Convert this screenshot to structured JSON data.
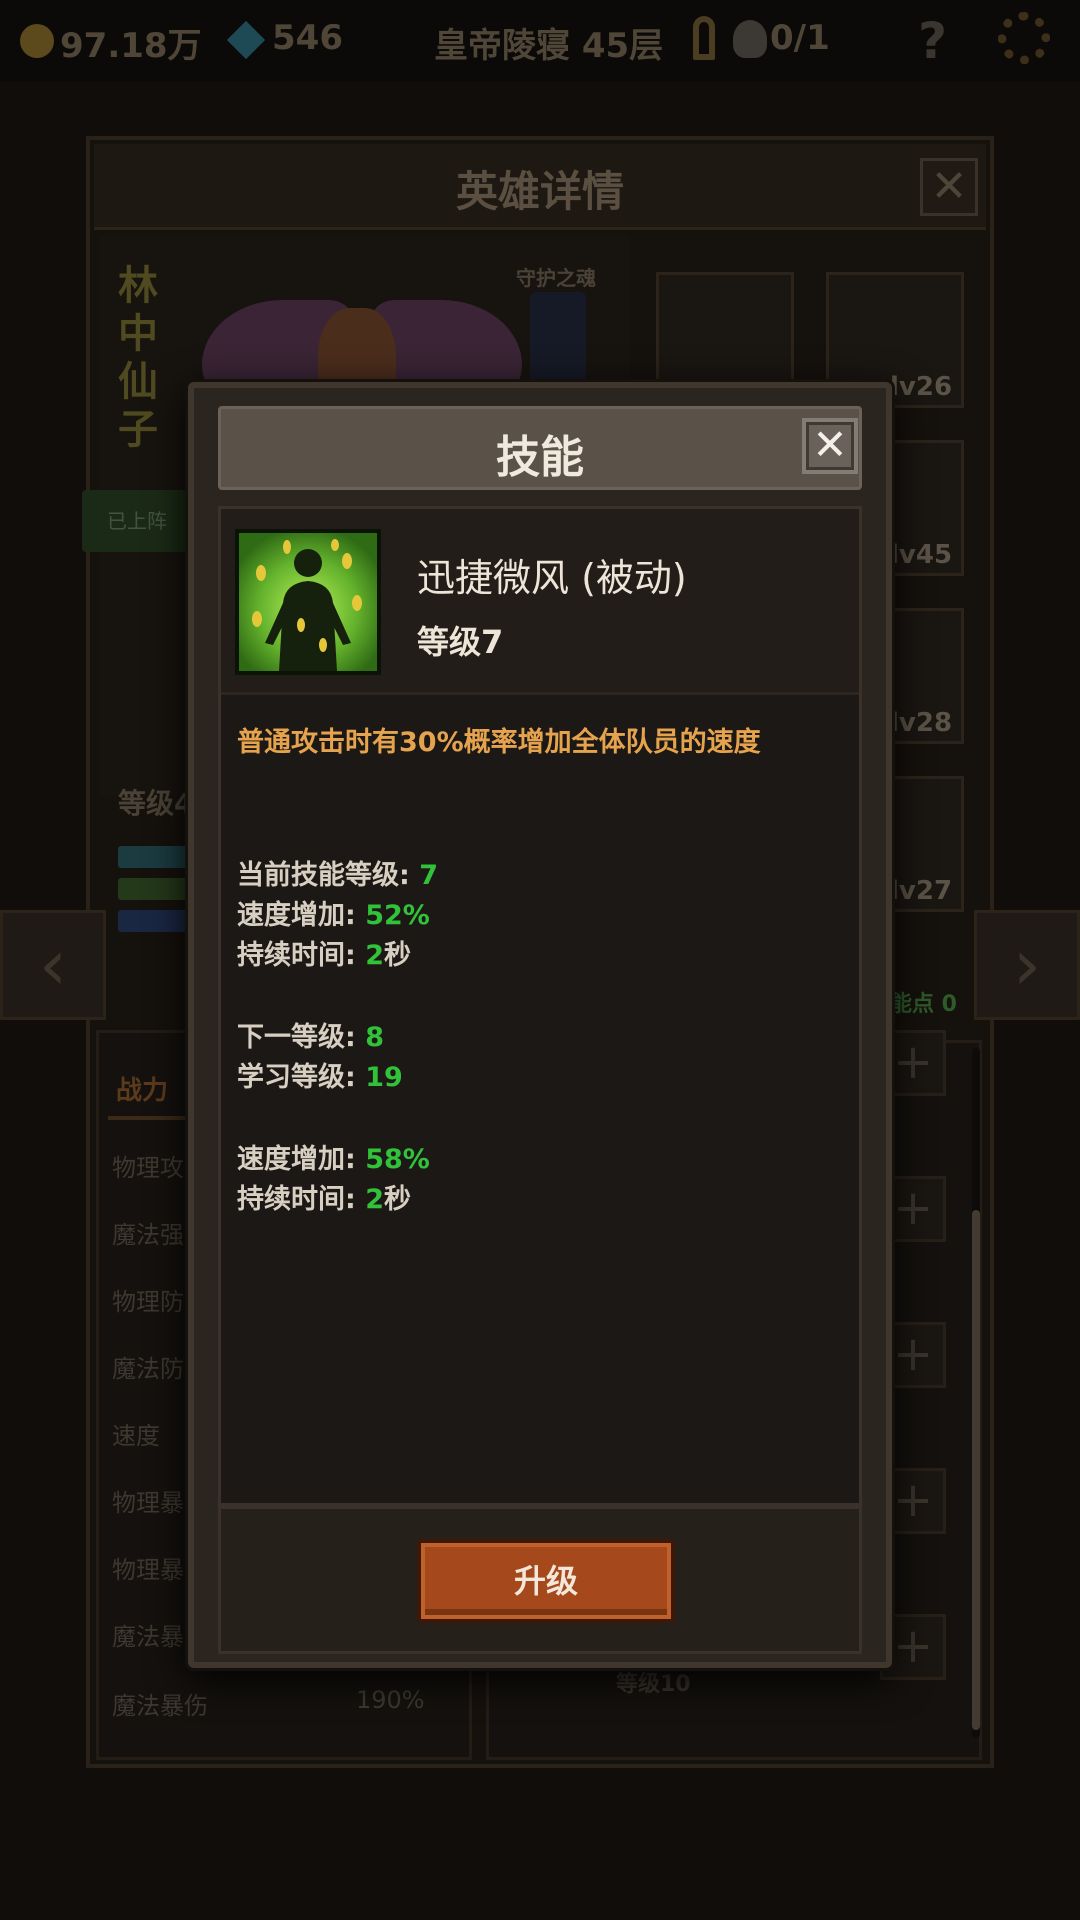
{
  "topbar": {
    "gold": "97.18万",
    "diamonds": "546",
    "stage": "皇帝陵寝 45层",
    "keys": "0/1"
  },
  "hero_panel": {
    "title": "英雄详情",
    "close": "✕",
    "hero_name": "林中仙子",
    "guardian_label": "守护之魂",
    "deployed_label": "已上阵",
    "level_label": "等级4",
    "equipment": [
      {
        "level": "lv26"
      },
      {
        "level": "lv45"
      },
      {
        "level": "lv28"
      },
      {
        "level": "lv27"
      }
    ],
    "skill_points": "能点 0",
    "stats_tab": "战力",
    "stats": [
      {
        "name": "物理攻"
      },
      {
        "name": "魔法强"
      },
      {
        "name": "物理防"
      },
      {
        "name": "魔法防"
      },
      {
        "name": "速度"
      },
      {
        "name": "物理暴"
      },
      {
        "name": "物理暴"
      },
      {
        "name": "魔法暴"
      },
      {
        "name": "魔法暴伤",
        "value": "190%"
      }
    ],
    "skill_level_bg": "等级10",
    "nav_left": "‹",
    "nav_right": "›"
  },
  "skill_modal": {
    "title": "技能",
    "close": "✕",
    "skill_name": "迅捷微风 (被动)",
    "skill_level": "等级7",
    "description": "普通攻击时有30%概率增加全体队员的速度",
    "current": [
      {
        "label": "当前技能等级: ",
        "value": "7"
      },
      {
        "label": "速度增加: ",
        "value": "52%"
      },
      {
        "label": "持续时间: ",
        "value": "2",
        "suffix": "秒"
      }
    ],
    "next": [
      {
        "label": "下一等级: ",
        "value": "8"
      },
      {
        "label": "学习等级: ",
        "value": "19"
      }
    ],
    "next_effects": [
      {
        "label": "速度增加: ",
        "value": "58%"
      },
      {
        "label": "持续时间: ",
        "value": "2",
        "suffix": "秒"
      }
    ],
    "upgrade_label": "升级"
  },
  "colors": {
    "desc_orange": "#e6a34e",
    "value_green": "#31c23a",
    "button": "#a5481c"
  }
}
